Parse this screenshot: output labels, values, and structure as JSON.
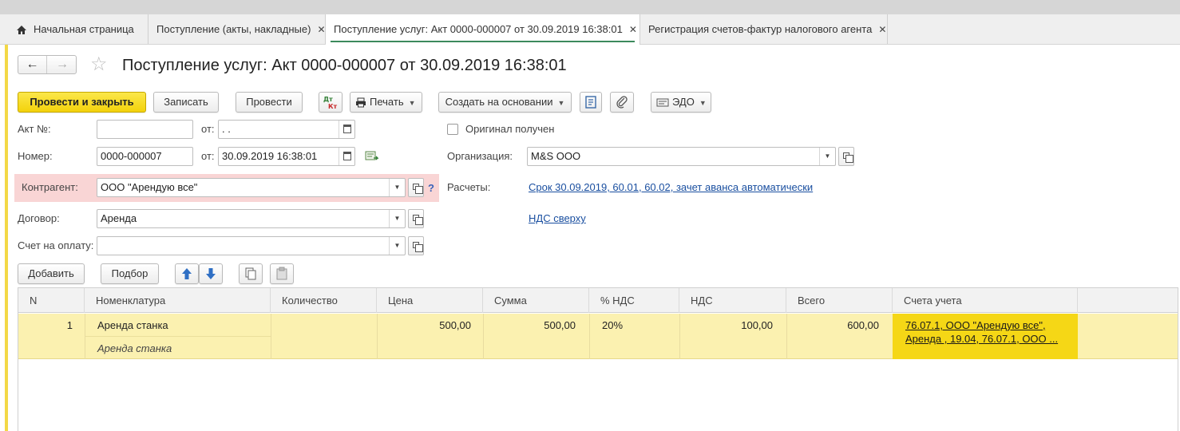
{
  "tabs": [
    {
      "label": "Начальная страница"
    },
    {
      "label": "Поступление (акты, накладные)"
    },
    {
      "label": "Поступление услуг: Акт 0000-000007 от 30.09.2019 16:38:01"
    },
    {
      "label": "Регистрация счетов-фактур налогового агента"
    }
  ],
  "header": {
    "title": "Поступление услуг: Акт 0000-000007 от 30.09.2019 16:38:01"
  },
  "toolbar": {
    "post_close_label": "Провести и закрыть",
    "save_label": "Записать",
    "post_label": "Провести",
    "dtkt_label": "Дт Кт",
    "print_label": "Печать",
    "create_based_label": "Создать на основании",
    "edo_label": "ЭДО"
  },
  "form": {
    "act_no_label": "Акт №:",
    "act_no_value": "",
    "act_from_label": "от:",
    "act_date_value": " .  .",
    "original_received_label": "Оригинал получен",
    "original_received": false,
    "number_label": "Номер:",
    "number_value": "0000-000007",
    "number_from_label": "от:",
    "number_date_value": "30.09.2019 16:38:01",
    "organization_label": "Организация:",
    "organization_value": "M&S OOO",
    "counterparty_label": "Контрагент:",
    "counterparty_value": "ООО \"Арендую все\"",
    "help_mark": "?",
    "settlements_label": "Расчеты:",
    "settlements_link": "Срок 30.09.2019, 60.01, 60.02, зачет аванса автоматически",
    "contract_label": "Договор:",
    "contract_value": "Аренда",
    "vat_link": "НДС сверху",
    "invoice_label": "Счет на оплату:",
    "invoice_value": ""
  },
  "table_toolbar": {
    "add_label": "Добавить",
    "pick_label": "Подбор"
  },
  "table": {
    "columns": [
      "N",
      "Номенклатура",
      "Количество",
      "Цена",
      "Сумма",
      "% НДС",
      "НДС",
      "Всего",
      "Счета учета"
    ],
    "rows": [
      {
        "n": "1",
        "item": "Аренда станка",
        "item_content": "Аренда станка",
        "qty": "",
        "price": "500,00",
        "sum": "500,00",
        "vat_rate": "20%",
        "vat": "100,00",
        "total": "600,00",
        "accounts_line1": "76.07.1, ООО \"Арендую все\",",
        "accounts_line2": "Аренда , 19.04, 76.07.1, ООО ..."
      }
    ]
  },
  "colors": {
    "primary_button": "#f3d20b",
    "active_row": "#fbf1b0",
    "accounts_cell": "#f5d716",
    "error_highlight": "#f9d5d5",
    "link": "#1a4fa0"
  }
}
